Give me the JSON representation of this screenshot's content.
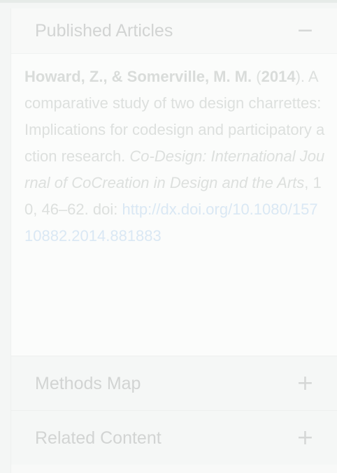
{
  "accordion": {
    "published": {
      "title": "Published Articles",
      "toggle": "−",
      "citation": {
        "authors": "Howard, Z., & Somerville, M. M.",
        "year_open": "(",
        "year": "2014",
        "year_close": ").",
        "title_text": " A comparative study of two design charrettes: Implications for codesign and participatory action research. ",
        "journal": "Co-Design: International Journal of CoCreation in Design and the Arts",
        "details": ", 10, 46–62. doi: ",
        "doi": "http://dx.doi.org/10.1080/15710882.2014.881883"
      }
    },
    "methods_map": {
      "title": "Methods Map",
      "toggle": "+"
    },
    "related": {
      "title": "Related Content",
      "toggle": "+"
    }
  }
}
